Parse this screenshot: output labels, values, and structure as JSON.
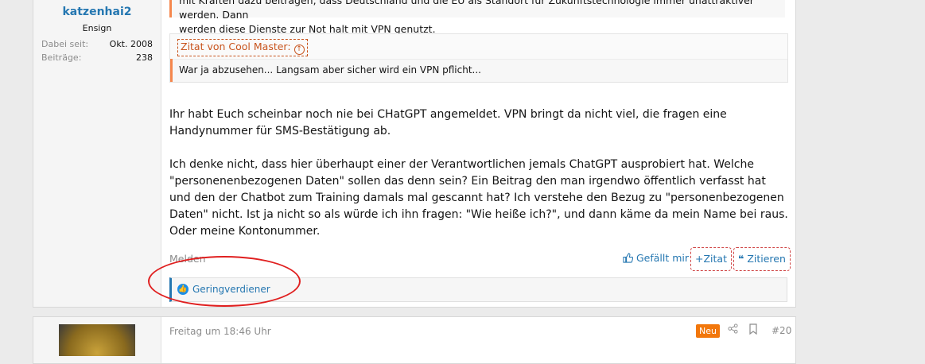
{
  "user": {
    "name": "katzenhai2",
    "title": "Ensign",
    "joined_label": "Dabei seit:",
    "joined_value": "Okt. 2008",
    "posts_label": "Beiträge:",
    "posts_value": "238"
  },
  "quote1": {
    "line1": "mit Kräften dazu beitragen, dass Deutschland und die EU als Standort für Zukunftstechnologie immer unattraktiver werden. Dann",
    "line2": "werden diese Dienste zur Not halt mit VPN genutzt."
  },
  "quote2": {
    "attribution": "Zitat von Cool Master:",
    "expand_icon": "arrow-circle-up-icon",
    "text": "War ja abzusehen... Langsam aber sicher wird ein VPN pflicht..."
  },
  "message": {
    "p1": "Ihr habt Euch scheinbar noch nie bei CHatGPT angemeldet. VPN bringt da nicht viel, die fragen eine Handynummer für SMS-Bestätigung ab.",
    "p2": "Ich denke nicht, dass hier überhaupt einer der Verantwortlichen jemals ChatGPT ausprobiert hat. Welche \"personenenbezogenen Daten\" sollen das denn sein? Ein Beitrag den man irgendwo öffentlich verfasst hat und den der Chatbot zum Training damals mal gescannt hat? Ich verstehe den Bezug zu \"personenbezogenen Daten\" nicht. Ist ja nicht so als würde ich ihn fragen: \"Wie heiße ich?\", und dann käme da mein Name bei raus. Oder meine Kontonummer."
  },
  "actions": {
    "report": "Melden",
    "like": "Gefällt mir",
    "multiquote": "Zitat",
    "quote": "Zitieren"
  },
  "reactions": {
    "icon": "thumbs-up-icon",
    "text": "Geringverdiener"
  },
  "next_post": {
    "date": "Freitag um 18:46 Uhr",
    "badge": "Neu",
    "number": "#20"
  },
  "colors": {
    "link": "#2577b1",
    "quote_accent": "#f5874d",
    "badge_new": "#f2770b",
    "annotation": "#e02020"
  }
}
